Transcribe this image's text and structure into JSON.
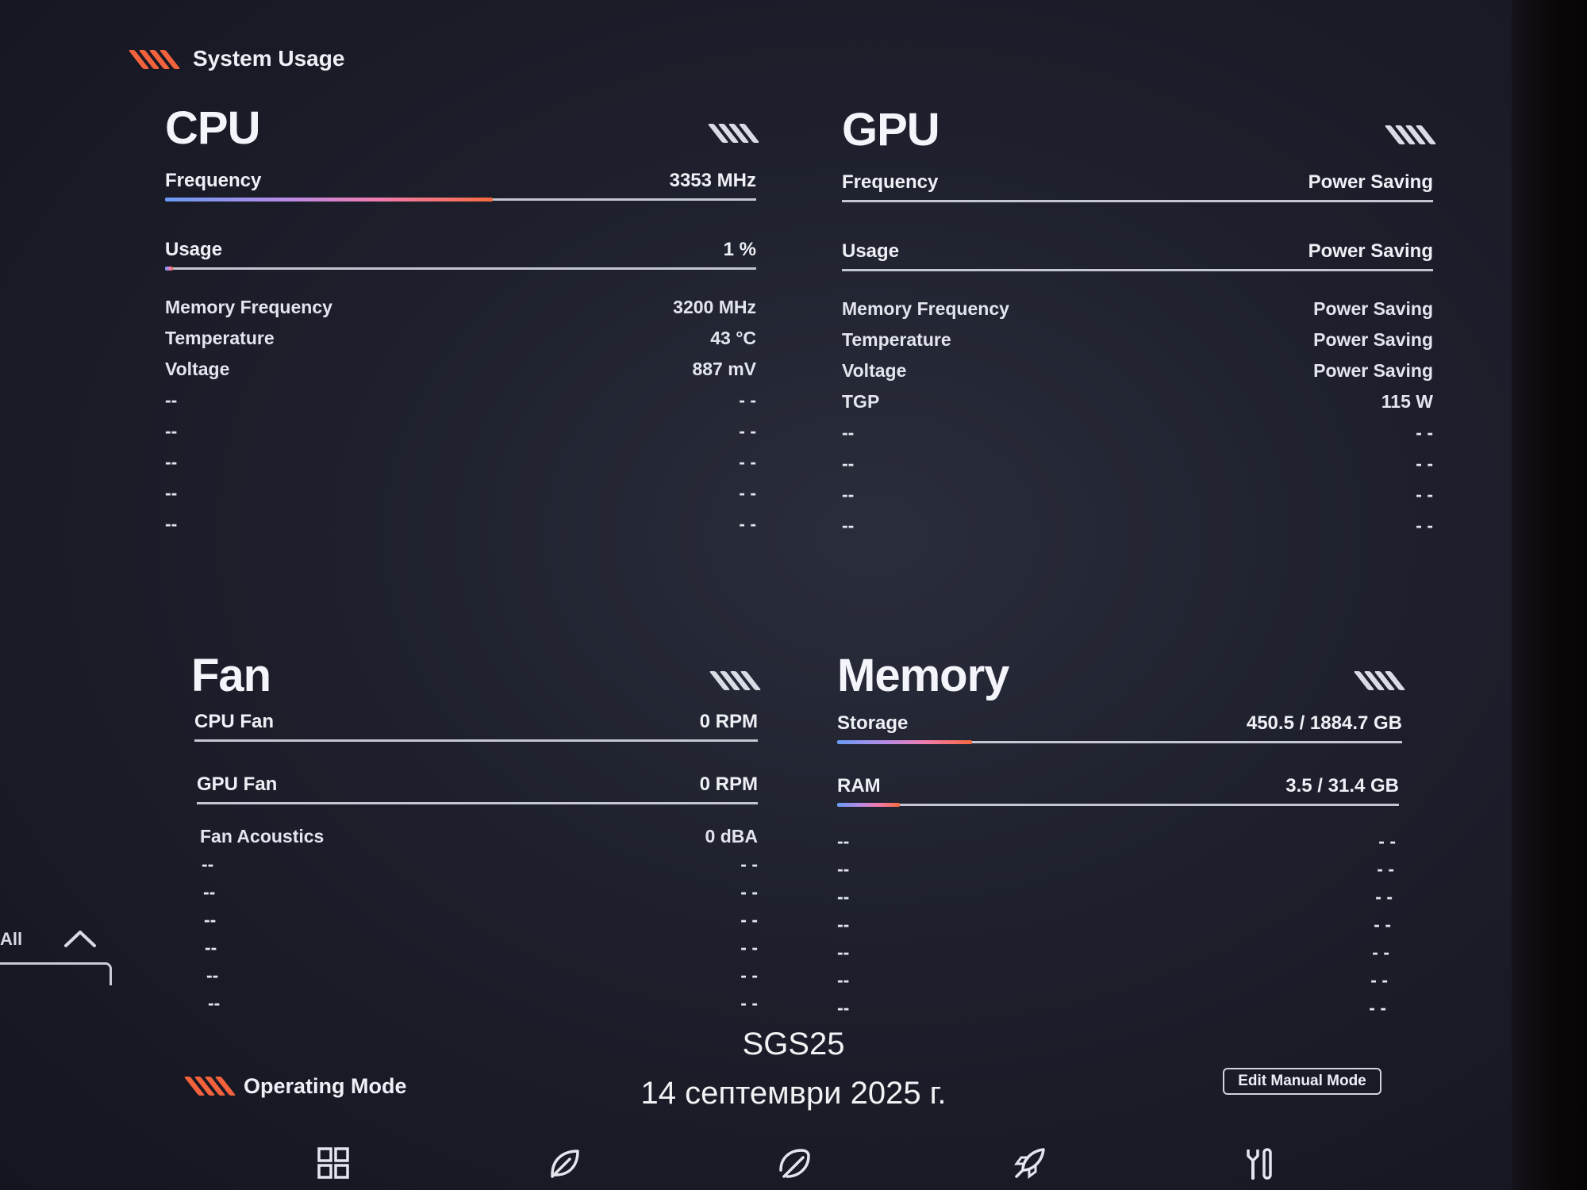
{
  "header": {
    "title": "System Usage"
  },
  "cpu": {
    "title": "CPU",
    "frequency": {
      "label": "Frequency",
      "value": "3353 MHz",
      "fill": 0.555
    },
    "usage": {
      "label": "Usage",
      "value": "1 %",
      "fill": 0.01
    },
    "rows": [
      {
        "label": "Memory Frequency",
        "value": "3200 MHz"
      },
      {
        "label": "Temperature",
        "value": "43 °C"
      },
      {
        "label": "Voltage",
        "value": "887 mV"
      },
      {
        "label": "--",
        "value": "- -"
      },
      {
        "label": "--",
        "value": "- -"
      },
      {
        "label": "--",
        "value": "- -"
      },
      {
        "label": "--",
        "value": "- -"
      },
      {
        "label": "--",
        "value": "- -"
      }
    ]
  },
  "gpu": {
    "title": "GPU",
    "frequency": {
      "label": "Frequency",
      "value": "Power Saving",
      "fill": 0
    },
    "usage": {
      "label": "Usage",
      "value": "Power Saving",
      "fill": 0
    },
    "rows": [
      {
        "label": "Memory Frequency",
        "value": "Power Saving"
      },
      {
        "label": "Temperature",
        "value": "Power Saving"
      },
      {
        "label": "Voltage",
        "value": "Power Saving"
      },
      {
        "label": "TGP",
        "value": "115 W"
      },
      {
        "label": "--",
        "value": "- -"
      },
      {
        "label": "--",
        "value": "- -"
      },
      {
        "label": "--",
        "value": "- -"
      },
      {
        "label": "--",
        "value": "- -"
      }
    ]
  },
  "fan": {
    "title": "Fan",
    "cpu_fan": {
      "label": "CPU Fan",
      "value": "0 RPM",
      "fill": 0
    },
    "gpu_fan": {
      "label": "GPU Fan",
      "value": "0 RPM",
      "fill": 0
    },
    "rows": [
      {
        "label": "Fan Acoustics",
        "value": "0 dBA"
      },
      {
        "label": "--",
        "value": "- -"
      },
      {
        "label": "--",
        "value": "- -"
      },
      {
        "label": "--",
        "value": "- -"
      },
      {
        "label": "--",
        "value": "- -"
      },
      {
        "label": "--",
        "value": "- -"
      },
      {
        "label": "--",
        "value": "- -"
      }
    ]
  },
  "memory": {
    "title": "Memory",
    "storage": {
      "label": "Storage",
      "value": "450.5 / 1884.7 GB",
      "fill": 0.239
    },
    "ram": {
      "label": "RAM",
      "value": "3.5 / 31.4 GB",
      "fill": 0.111
    },
    "rows": [
      {
        "label": "--",
        "value": "- -"
      },
      {
        "label": "--",
        "value": "- -"
      },
      {
        "label": "--",
        "value": "- -"
      },
      {
        "label": "--",
        "value": "- -"
      },
      {
        "label": "--",
        "value": "- -"
      },
      {
        "label": "--",
        "value": "- -"
      },
      {
        "label": "--",
        "value": "- -"
      }
    ]
  },
  "operating_mode": {
    "title": "Operating Mode",
    "edit_button": "Edit Manual Mode"
  },
  "filter": {
    "label": "All"
  },
  "watermark": {
    "device": "SGS25",
    "date": "14 септември 2025 г."
  },
  "nav": [
    {
      "icon": "dashboard-grid-icon"
    },
    {
      "icon": "leaf-icon"
    },
    {
      "icon": "balance-mode-icon"
    },
    {
      "icon": "rocket-icon"
    },
    {
      "icon": "tools-icon"
    }
  ],
  "colors": {
    "accent": "#f2623c",
    "bar_start": "#6a9af2",
    "bar_end": "#f66a3f"
  }
}
